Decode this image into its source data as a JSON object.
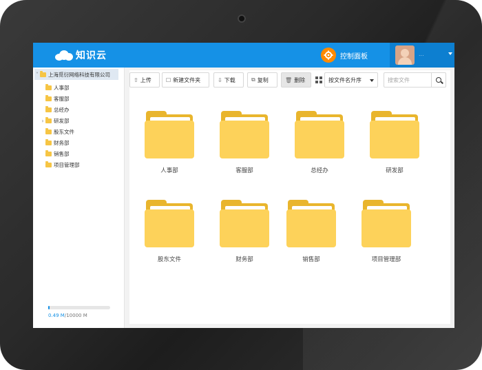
{
  "app": {
    "logo_text": "知识云",
    "control_panel_label": "控制面板",
    "user_name": "..."
  },
  "sidebar": {
    "root_label": "上海觅衍网络科技有限公司",
    "items": [
      {
        "label": "人事部",
        "expandable": false
      },
      {
        "label": "客服部",
        "expandable": false
      },
      {
        "label": "总经办",
        "expandable": false
      },
      {
        "label": "研发部",
        "expandable": true
      },
      {
        "label": "股东文件",
        "expandable": false
      },
      {
        "label": "财务部",
        "expandable": false
      },
      {
        "label": "销售部",
        "expandable": false
      },
      {
        "label": "项目管理部",
        "expandable": false
      }
    ],
    "storage_used": "0.49 M",
    "storage_total": "/10000 M",
    "storage_fraction": 0.0049
  },
  "toolbar": {
    "upload_label": "上传",
    "new_folder_label": "新建文件夹",
    "download_label": "下载",
    "copy_label": "复制",
    "delete_label": "删除",
    "sort_value": "按文件名升序",
    "search_placeholder": "搜索文件"
  },
  "folders": [
    {
      "label": "人事部"
    },
    {
      "label": "客服部"
    },
    {
      "label": "总经办"
    },
    {
      "label": "研发部"
    },
    {
      "label": "股东文件"
    },
    {
      "label": "财务部"
    },
    {
      "label": "销售部"
    },
    {
      "label": "项目管理部"
    }
  ],
  "colors": {
    "header_blue": "#1591e6",
    "folder_yellow": "#fdd25a",
    "control_panel_orange": "#ff8a00"
  }
}
